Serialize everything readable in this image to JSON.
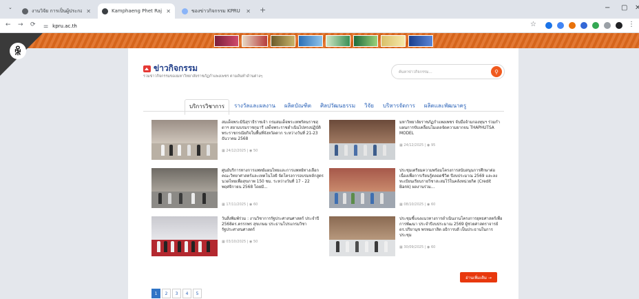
{
  "browser": {
    "tabs": [
      {
        "title": "งานวิจัย การเป็นผู้ประกอบการ",
        "active": false,
        "color": "#5f6368"
      },
      {
        "title": "Kamphaeng Phet Rajabhat Uni",
        "active": true,
        "color": "#3c4043"
      },
      {
        "title": "ของข่าวกิจกรรม KPRU",
        "active": false,
        "color": "#8ab4f8"
      }
    ],
    "new_tab": "+",
    "url": "kpru.ac.th",
    "window_controls": [
      "−",
      "▢",
      "✕"
    ]
  },
  "site": {
    "section_title": "ข่าวกิจกรรม",
    "section_subtitle": "รวมข่าวกิจกรรมของมหาวิทยาลัยราชภัฏกำแพงเพชร ตามดันทำด้านต่างๆ",
    "search": {
      "placeholder": "ค้นหาข่าวกิจกรรม..."
    },
    "tabs": [
      {
        "label": "บริการวิชาการ",
        "active": true
      },
      {
        "label": "รางวัลและผลงาน",
        "active": false
      },
      {
        "label": "ผลิตบัณฑิต",
        "active": false
      },
      {
        "label": "ศิลปวัฒนธรรม",
        "active": false
      },
      {
        "label": "วิจัย",
        "active": false
      },
      {
        "label": "บริหารจัดการ",
        "active": false
      },
      {
        "label": "ผลิตและพัฒนาครู",
        "active": false
      }
    ],
    "news": [
      {
        "headline": "สมเด็จพระมินิสุราธิราชเจ้า กรมสมเด็จพระเทพรัตนราชสุดาฯ สยามบรมราชกุมารี เสด็จพระราชดำเนินไปทรงปฏิบัติพระราชกรณียกิจในพื้นที่จังหวัดตาก ระหว่างวันที่ 21-23 ธันวาคม 2568",
        "date": "24/12/2025",
        "views": "50"
      },
      {
        "headline": "มหาวิทยาลัยราชภัฏกำแพงเพชร จับมือจ้ามกองทุนฯ ร่วมกำแผนการขับเคลื่อนโมเดลจัดความยากจน THAPHUTSA MODEL",
        "date": "24/12/2025",
        "views": "95"
      },
      {
        "headline": "ศูนย์บริการทางการแพทย์แผนไทยและการแพทย์ทางเลือก คณะวิทยาศาสตร์และเทคโนโลยี จัดโครงการอบรมหลักสูตรนวดไทยเพื่อสุขภาพ 150 ชม. ระหว่างวันที่ 17 - 22 พฤศจิกายน 2568 โดยมี...",
        "date": "17/11/2025",
        "views": "60"
      },
      {
        "headline": "ประชุมเตรียมความพร้อมโครงการสนับสนุนการศึกษาต่อเนื่องเพื่อการเรียนรู้ตลอดชีวิต ปีงบประมาณ 2569 และลงทะเบียนเรียนรายวิชาสะสมไว้ในคลังหน่วยกิต (Credit Bank) ผลงานร่วม...",
        "date": "08/10/2025",
        "views": "60"
      },
      {
        "headline": "วันสิ่งพิมพ์ร่วม : งานวิชาการรัฐประศาสนศาสตร์ ประจำปี 2568ดร.ตรรกพร สุขเกษม ประธานโปรแกรมวิชารัฐประศาสนศาสตร์",
        "date": "03/10/2025",
        "views": "50"
      },
      {
        "headline": "ประชุมชี้แจงแนวทางการดำเนินงานโครงการยุทธศาสตร์เพื่อการพัฒนา ประจำปีงบประมาณ 2569 ผู้ช่วยศาสตราจารย์ ดร.ปริยานุช พรหมภาสิต อธิการบดี เป็นประธานในการประชุม",
        "date": "30/09/2025",
        "views": "60"
      }
    ],
    "pagination": [
      "1",
      "2",
      "3",
      "4",
      "5"
    ],
    "read_more": "อ่านเพิ่มเติม →"
  },
  "icons": {
    "back": "←",
    "forward": "→",
    "reload": "⟳",
    "tune": "⚌",
    "star": "☆",
    "menu": "⋮",
    "search": "⚲",
    "calendar": "▦",
    "eye": "◉",
    "ribbon": "ꆜ"
  },
  "colors": {
    "brand_orange": "#e06a1d",
    "title_blue": "#1e3c88",
    "link_blue": "#2a62b8",
    "accent_red": "#e8380d"
  }
}
